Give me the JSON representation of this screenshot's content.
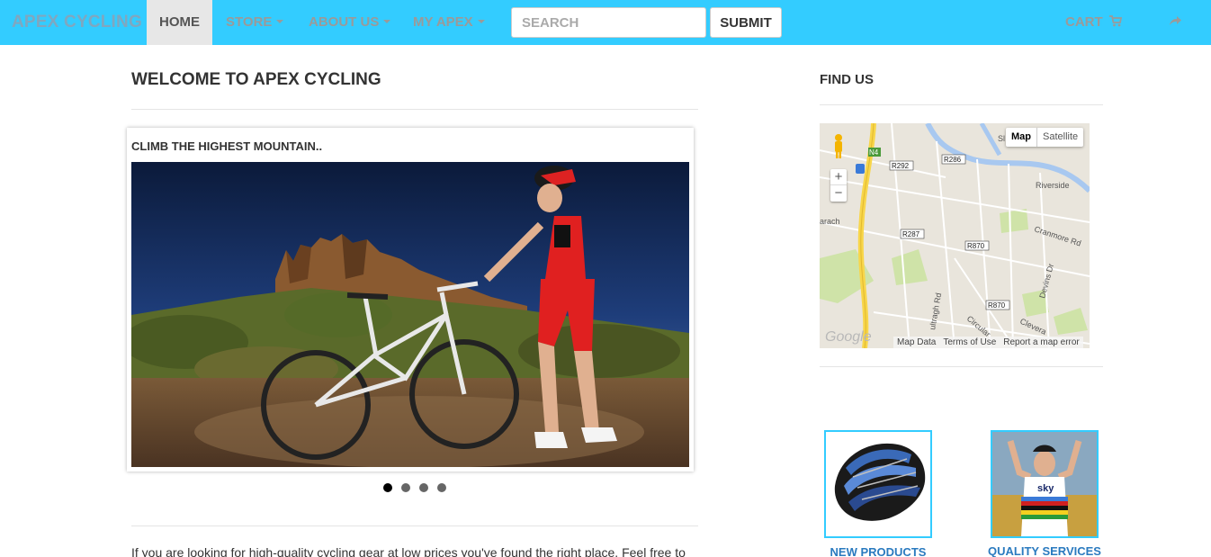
{
  "brand": "APEX CYCLING",
  "nav": {
    "home": "HOME",
    "store": "STORE",
    "about": "ABOUT US",
    "my_apex": "MY APEX",
    "search_placeholder": "SEARCH",
    "submit": "SUBMIT",
    "cart": "CART"
  },
  "main": {
    "title": "WELCOME TO APEX CYCLING",
    "slide_caption": "CLIMB THE HIGHEST MOUNTAIN..",
    "slides_count": 4,
    "active_slide": 1,
    "intro_text": "If you are looking for high-quality cycling gear at low prices you've found the right place. Feel free to"
  },
  "sidebar": {
    "find_us": "FIND US",
    "map": {
      "map_label": "Map",
      "satellite_label": "Satellite",
      "map_data": "Map Data",
      "terms": "Terms of Use",
      "report": "Report a map error",
      "zoom_in": "+",
      "zoom_out": "−",
      "logo": "Google",
      "labels": {
        "n4": "N4",
        "r292": "R292",
        "r286": "R286",
        "r287": "R287",
        "r870a": "R870",
        "r870b": "R870",
        "riverside": "Riverside",
        "cranmore": "Cranmore Rd",
        "devins": "Devins Dr",
        "ultragh": "ultragh Rd",
        "circular": "Circular",
        "clevera": "Clevera",
        "arach": "arach",
        "sl": "Sl"
      }
    },
    "tiles": {
      "new_products": "NEW PRODUCTS",
      "quality_services": "QUALITY SERVICES"
    }
  },
  "colors": {
    "navbar": "#33ccff",
    "link": "#2a7abf"
  }
}
